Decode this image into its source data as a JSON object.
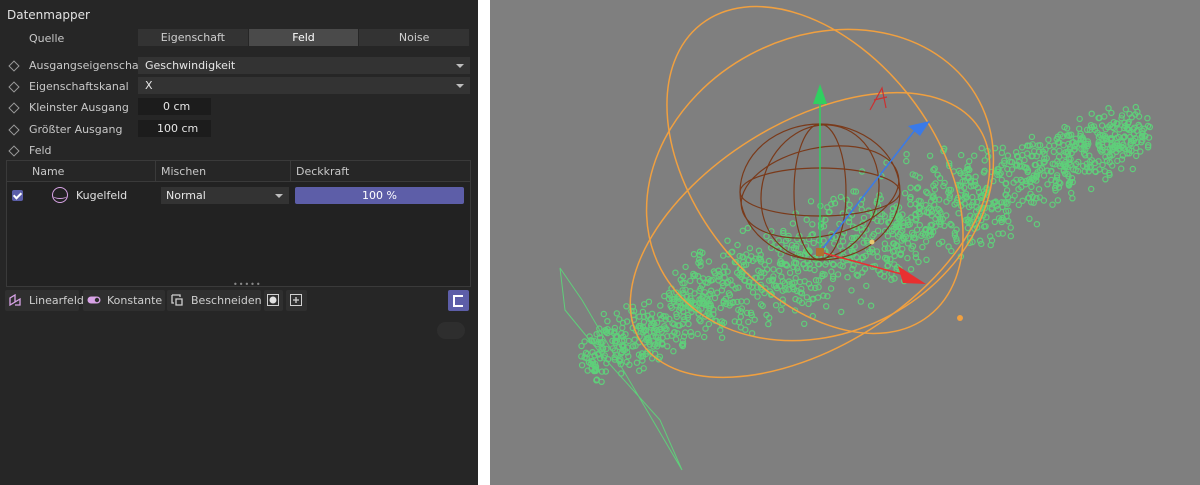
{
  "panel": {
    "title": "Datenmapper",
    "source_label": "Quelle",
    "tabs": [
      {
        "label": "Eigenschaft"
      },
      {
        "label": "Feld"
      },
      {
        "label": "Noise"
      }
    ],
    "output_property": {
      "label": "Ausgangseigenschaft",
      "value": "Geschwindigkeit"
    },
    "property_channel": {
      "label": "Eigenschaftskanal",
      "value": "X"
    },
    "min_output": {
      "label": "Kleinster Ausgang",
      "value": "0 cm"
    },
    "max_output": {
      "label": "Größter Ausgang",
      "value": "100 cm"
    },
    "field_label": "Feld",
    "table": {
      "columns": [
        "Name",
        "Mischen",
        "Deckkraft"
      ],
      "rows": [
        {
          "name": "Kugelfeld",
          "blend": "Normal",
          "opacity": "100 %",
          "enabled": true
        }
      ]
    },
    "toolbar": {
      "linear_label": "Linearfeld",
      "constant_label": "Konstante",
      "clip_label": "Beschneiden"
    }
  },
  "colors": {
    "accent": "#5d5ea8",
    "particles": "#5fcf7a",
    "orbit_rings": "#f0a040",
    "sphere_cage": "#7a3a1a",
    "axis_x": "#e83030",
    "axis_y": "#30d060",
    "axis_z": "#3a7ae8",
    "viewport_bg": "#7f7f7f"
  }
}
